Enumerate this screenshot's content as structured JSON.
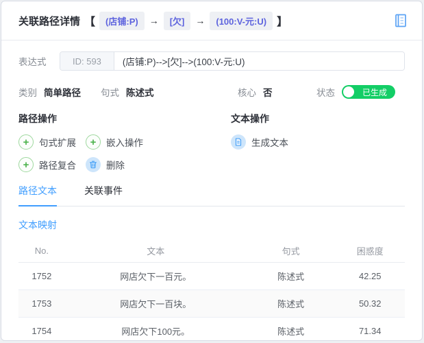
{
  "header": {
    "title": "关联路径详情",
    "bracket_open": "【",
    "bracket_close": "】",
    "arrow": "→",
    "path_nodes": [
      "(店铺:P)",
      "[欠]",
      "(100:V-元:U)"
    ],
    "icons": {
      "top_right": "notebook-icon"
    }
  },
  "expression": {
    "label": "表达式",
    "id_prefix": "ID: 593",
    "value": "(店铺:P)-->[欠]-->(100:V-元:U)"
  },
  "meta": {
    "category_label": "类别",
    "category_value": "简单路径",
    "sentence_label": "句式",
    "sentence_value": "陈述式",
    "core_label": "核心",
    "core_value": "否",
    "status_label": "状态",
    "status_value": "已生成"
  },
  "path_ops": {
    "title": "路径操作",
    "buttons": [
      {
        "label": "句式扩展",
        "icon": "plus-icon"
      },
      {
        "label": "嵌入操作",
        "icon": "plus-icon"
      },
      {
        "label": "路径复合",
        "icon": "plus-icon"
      },
      {
        "label": "删除",
        "icon": "trash-icon"
      }
    ]
  },
  "text_ops": {
    "title": "文本操作",
    "buttons": [
      {
        "label": "生成文本",
        "icon": "document-icon"
      }
    ]
  },
  "tabs": [
    {
      "label": "路径文本",
      "active": true
    },
    {
      "label": "关联事件",
      "active": false
    }
  ],
  "section": {
    "subtitle": "文本映射"
  },
  "table": {
    "columns": [
      "No.",
      "文本",
      "句式",
      "困惑度"
    ],
    "rows": [
      [
        "1752",
        "网店欠下一百元。",
        "陈述式",
        "42.25"
      ],
      [
        "1753",
        "网店欠下一百块。",
        "陈述式",
        "50.32"
      ],
      [
        "1754",
        "网店欠下100元。",
        "陈述式",
        "71.34"
      ]
    ]
  },
  "colors": {
    "accent_blue": "#409eff",
    "status_green": "#13ce66",
    "tag_purple": "#5d63de",
    "icon_blue": "#5ba3f5",
    "plus_green": "#4db34d"
  }
}
